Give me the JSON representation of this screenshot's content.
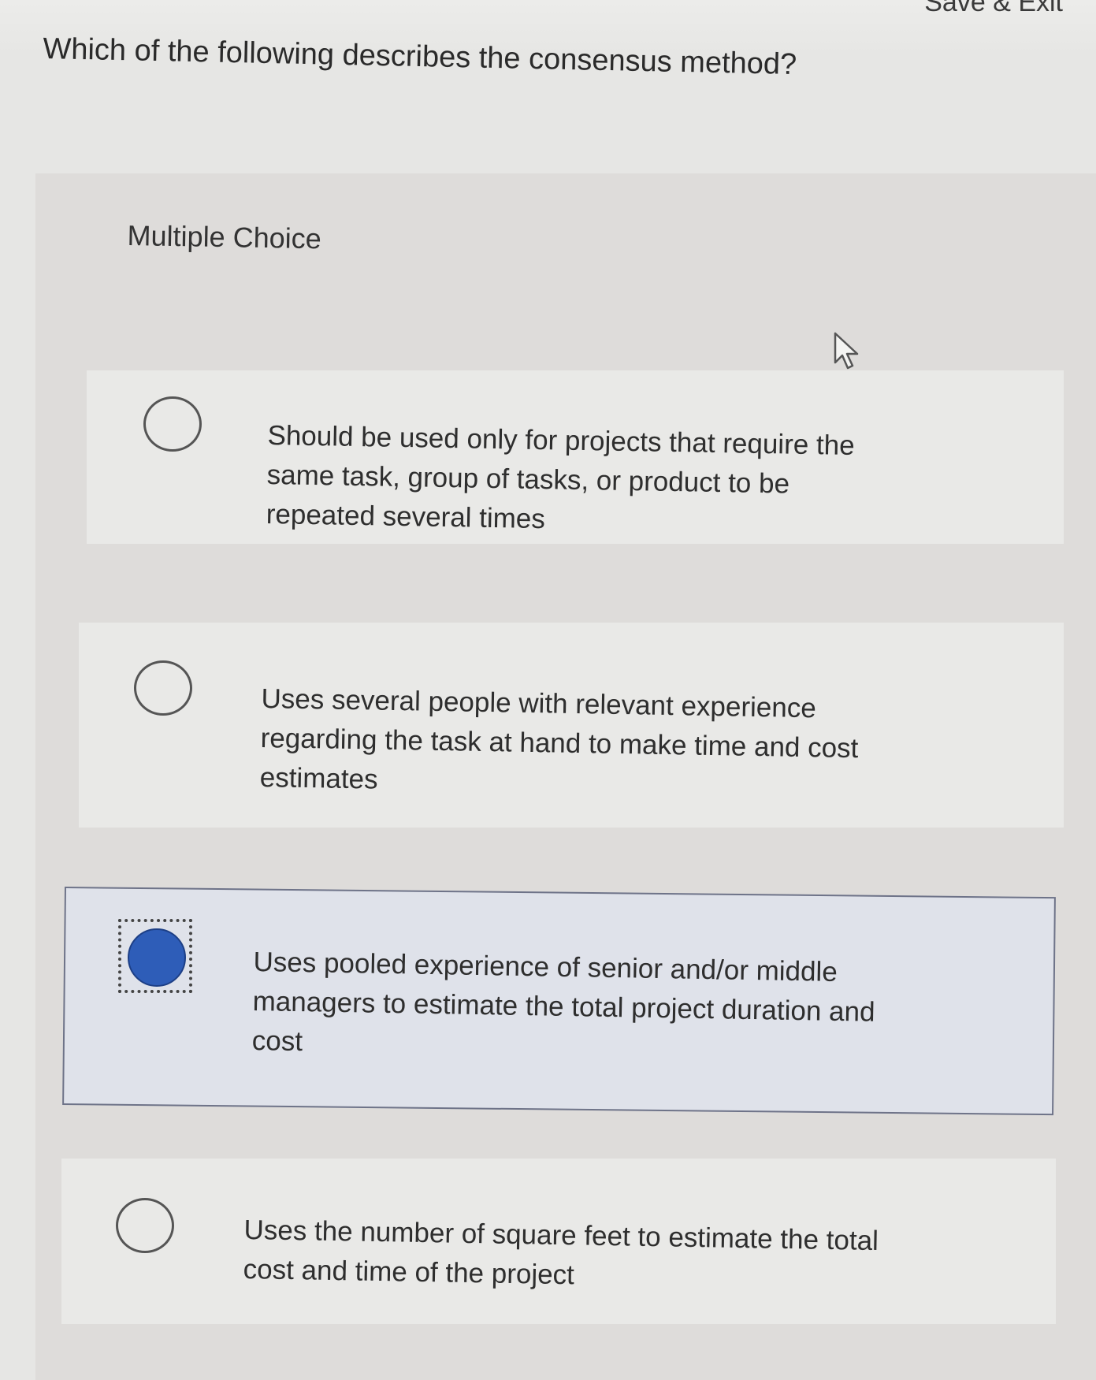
{
  "header": {
    "save_exit_label": "Save & Exit"
  },
  "question": {
    "text": "Which of the following describes the consensus method?"
  },
  "answer_panel": {
    "type_label": "Multiple Choice",
    "options": [
      {
        "text": "Should be used only for projects that require the same task, group of tasks, or product to be repeated several times",
        "selected": false
      },
      {
        "text": "Uses several people with relevant experience regarding the task at hand to make time and cost estimates",
        "selected": false
      },
      {
        "text": "Uses pooled experience of senior and/or middle managers to estimate the total project duration and cost",
        "selected": true
      },
      {
        "text": "Uses the number of square feet to estimate the total cost and time of the project",
        "selected": false
      }
    ]
  },
  "colors": {
    "selected_radio": "#2e5db8",
    "selected_option_bg": "#dfe2ea",
    "selected_option_border": "#6e7388"
  },
  "icons": {
    "pointer": "mouse-pointer-icon"
  }
}
